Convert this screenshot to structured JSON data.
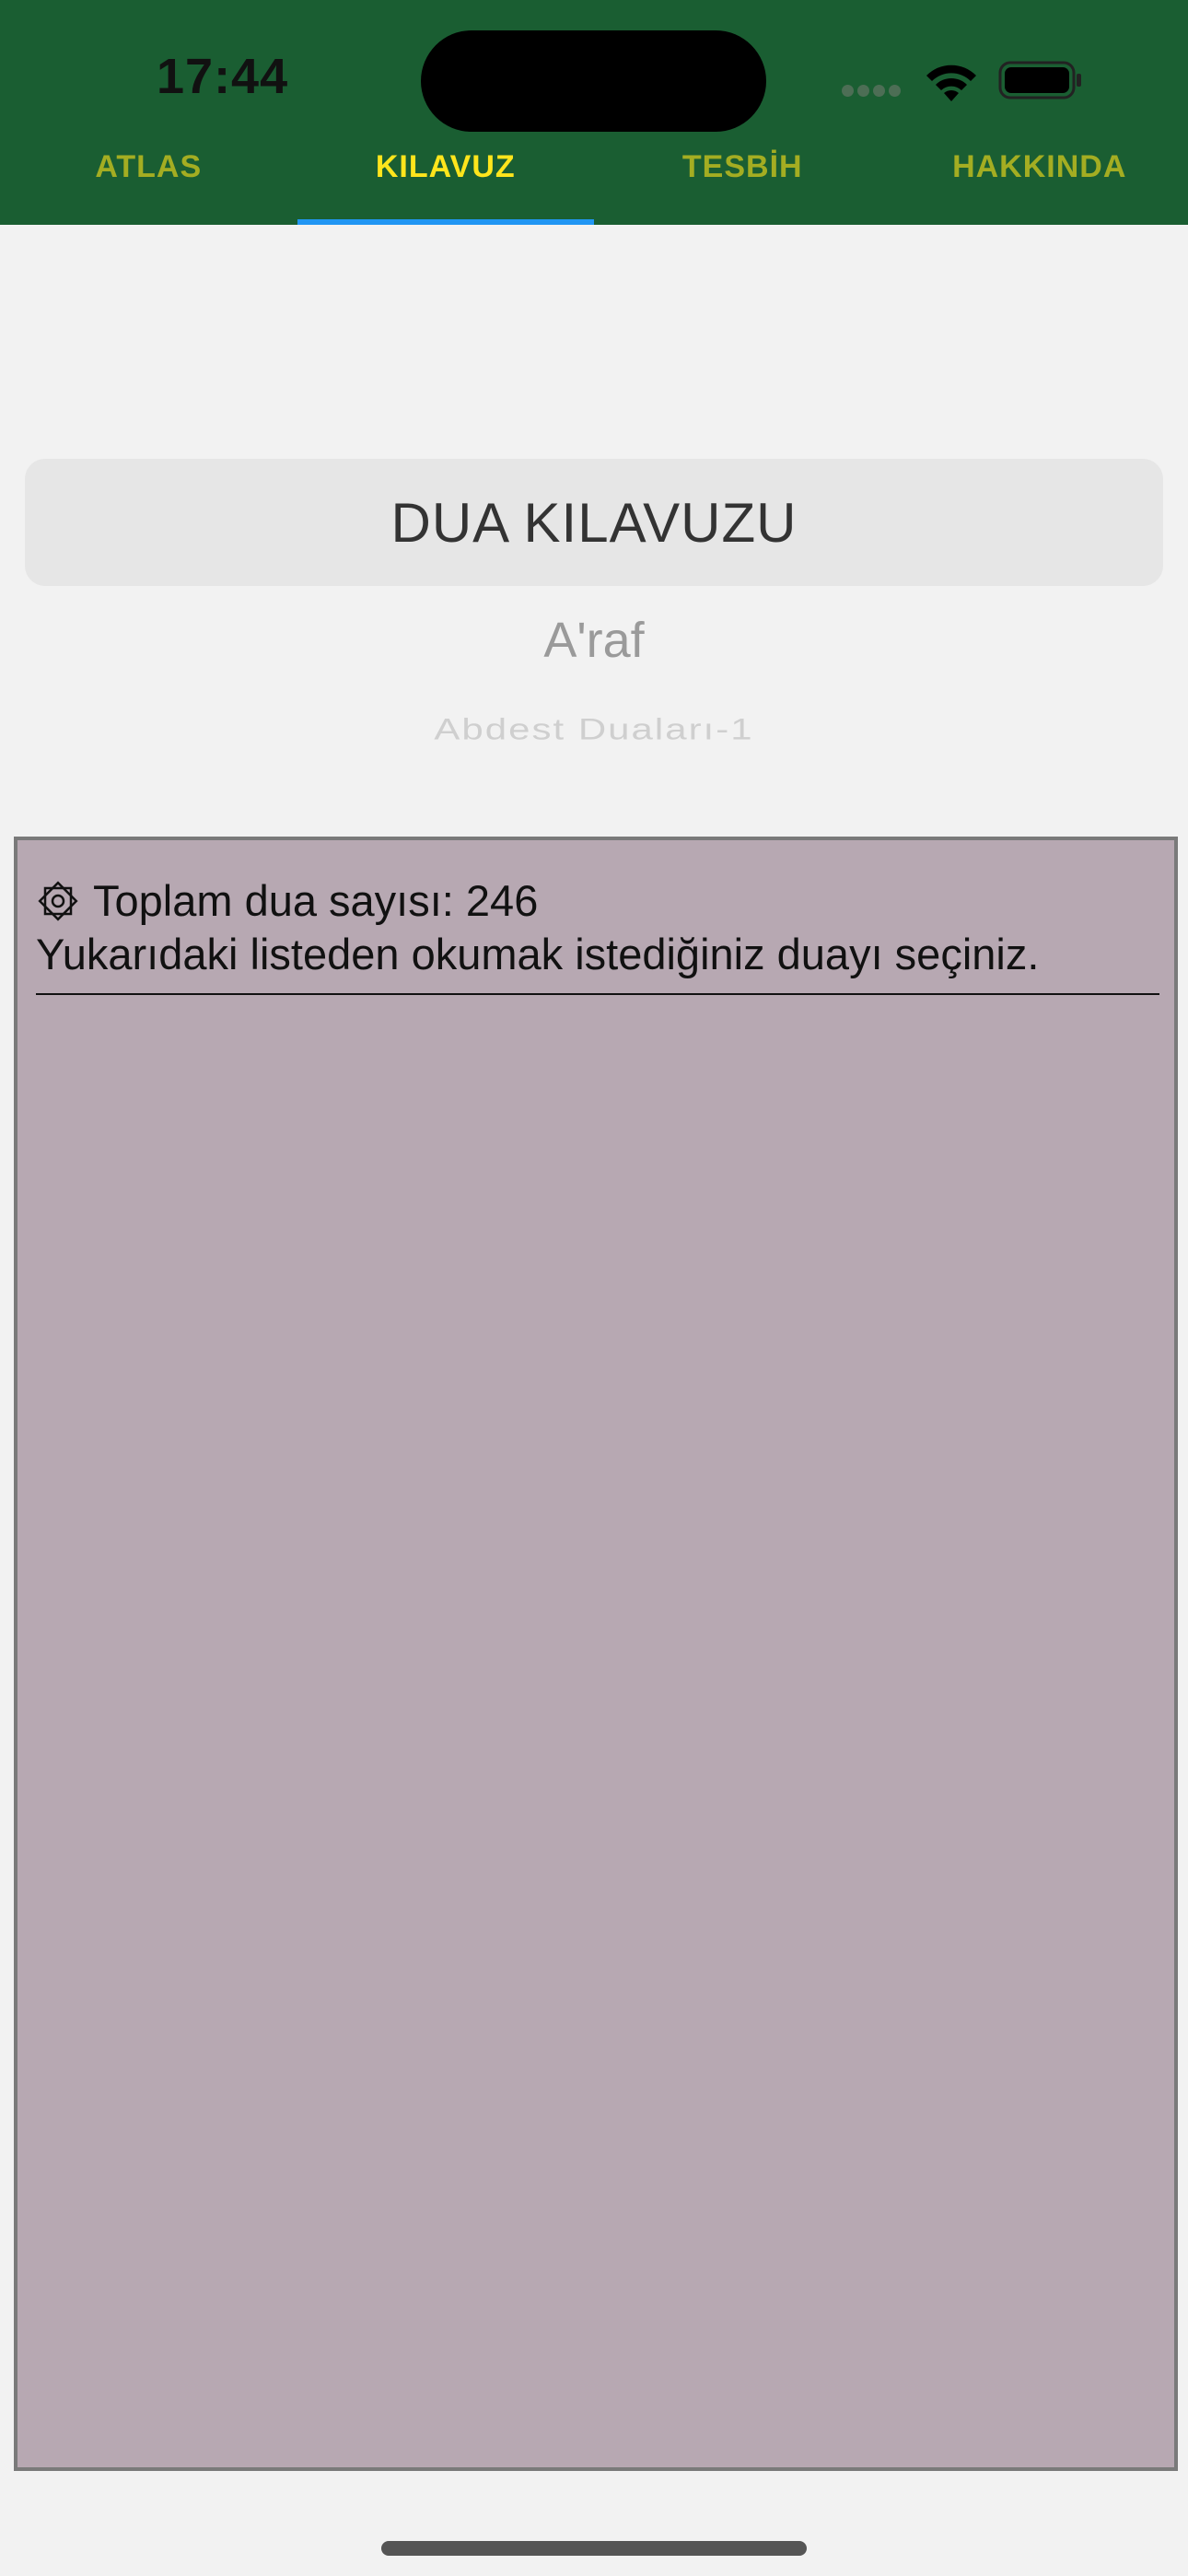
{
  "status_bar": {
    "time": "17:44"
  },
  "tabs": [
    {
      "label": "ATLAS",
      "active": false
    },
    {
      "label": "KILAVUZ",
      "active": true
    },
    {
      "label": "TESBİH",
      "active": false
    },
    {
      "label": "HAKKINDA",
      "active": false
    }
  ],
  "guide": {
    "title": "DUA KILAVUZU"
  },
  "picker": {
    "selected": "A'raf",
    "next": "Abdest Duaları-1"
  },
  "content": {
    "count_text": "Toplam dua sayısı: 246",
    "instruction": "Yukarıdaki listeden okumak istediğiniz duayı seçiniz."
  },
  "icons": {
    "wifi": "wifi-icon",
    "battery": "battery-icon",
    "signal": "cellular-signal-icon",
    "dua": "octagram-star-icon"
  },
  "colors": {
    "header_bg": "#1a5e32",
    "tab_inactive": "#a4ad22",
    "tab_active": "#ffe51c",
    "tab_indicator": "#2196f3",
    "panel_bg": "#b7a8b2"
  }
}
